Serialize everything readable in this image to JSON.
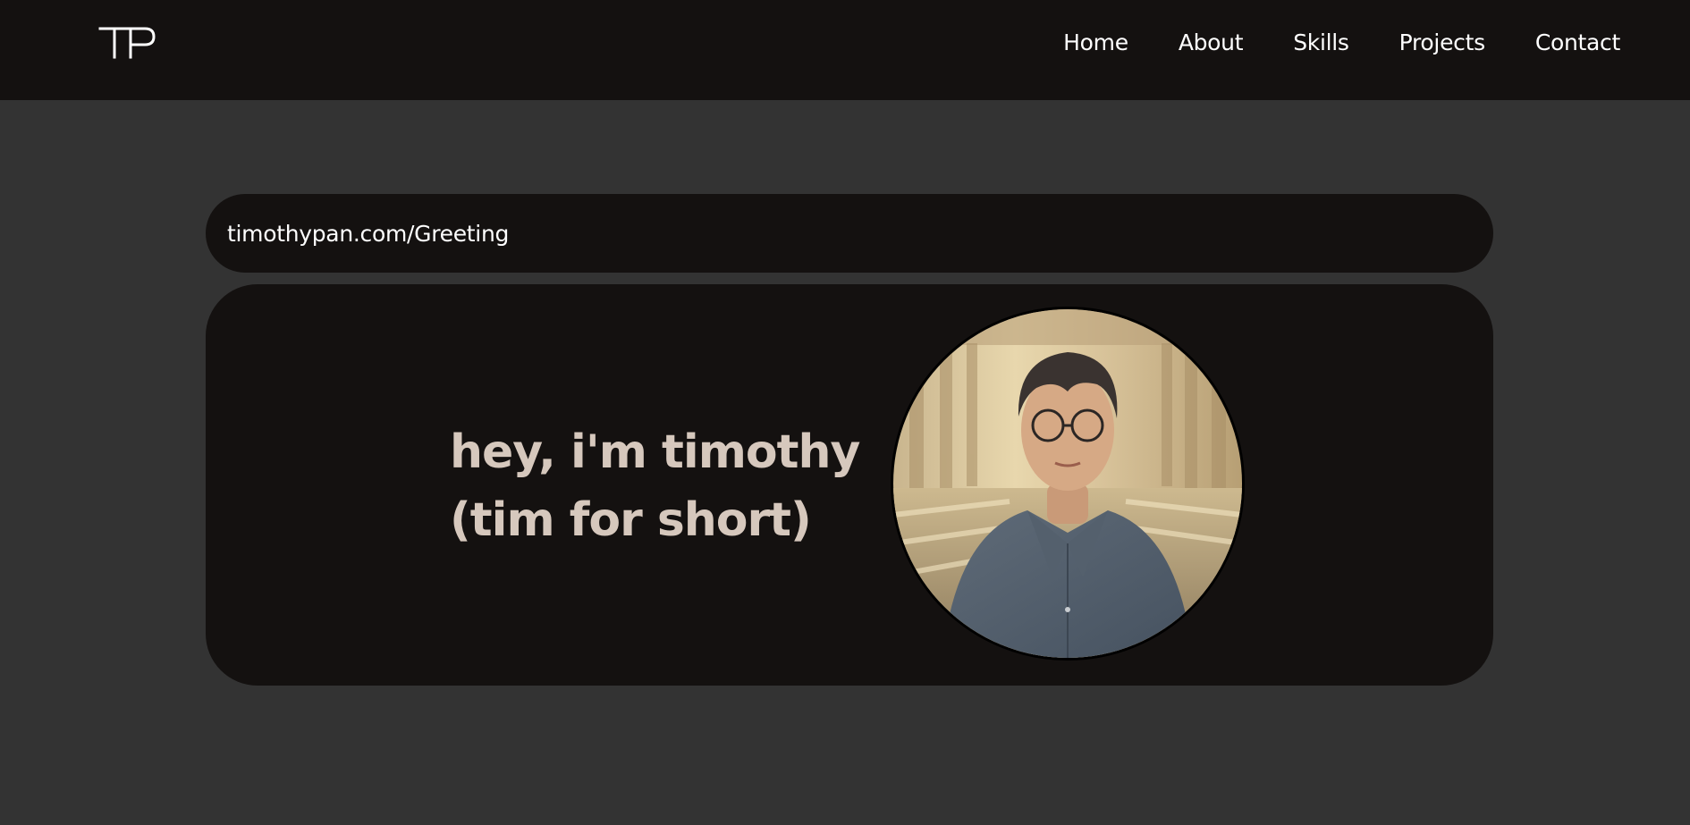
{
  "navbar": {
    "logo_text": "TP",
    "links": [
      {
        "label": "Home"
      },
      {
        "label": "About"
      },
      {
        "label": "Skills"
      },
      {
        "label": "Projects"
      },
      {
        "label": "Contact"
      }
    ]
  },
  "url_bar": {
    "text": "timothypan.com/Greeting"
  },
  "hero": {
    "line1": "hey, i'm timothy",
    "line2": "(tim for short)",
    "portrait_icon": "person-portrait-photo"
  },
  "colors": {
    "page_bg": "#333333",
    "panel_bg": "#141110",
    "greeting_text": "#d6c8bd",
    "nav_text": "#ffffff"
  }
}
